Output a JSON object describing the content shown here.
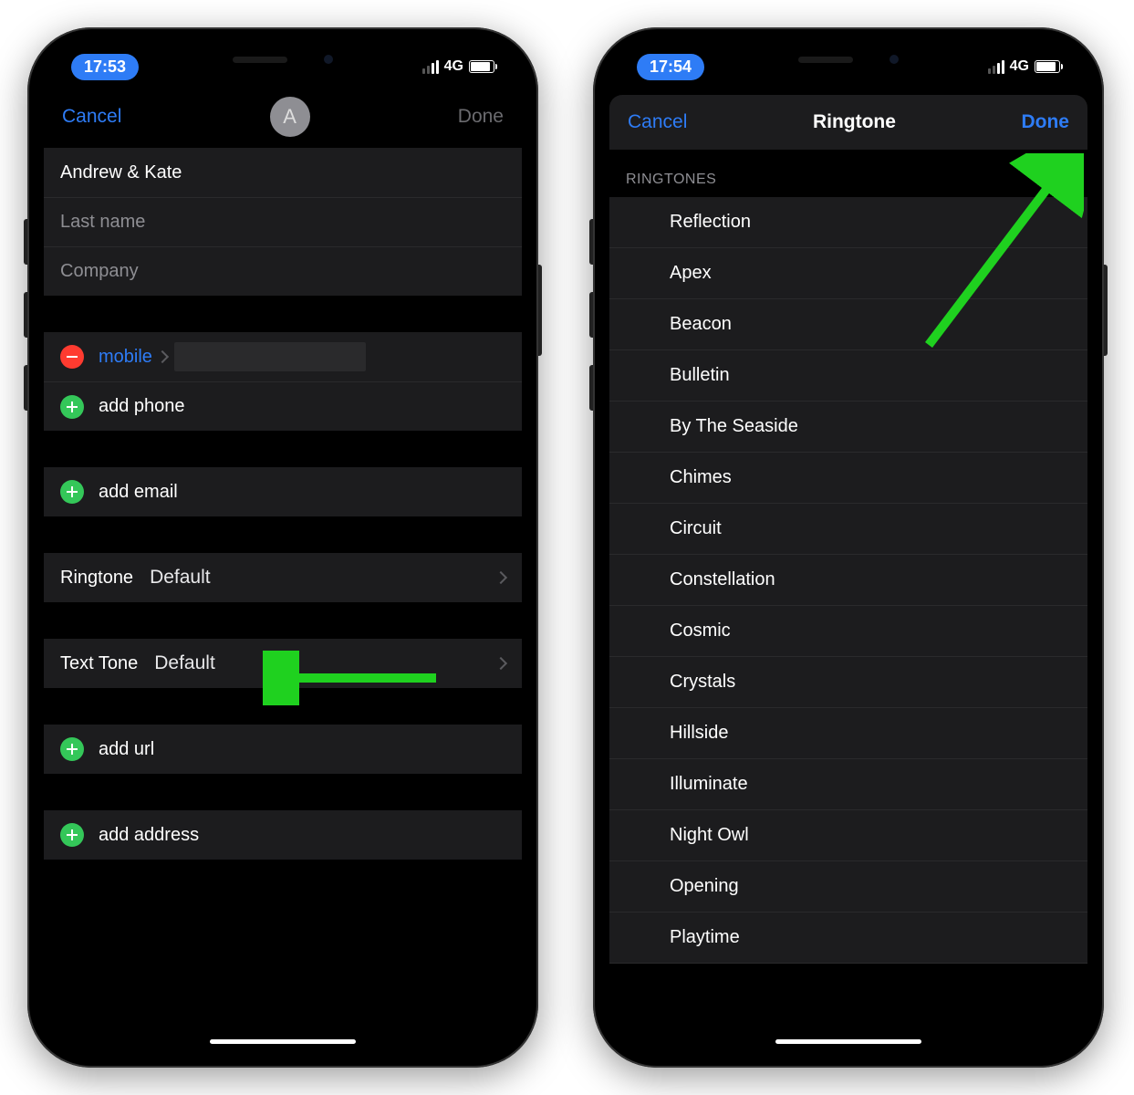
{
  "left": {
    "status": {
      "time": "17:53",
      "network": "4G"
    },
    "nav": {
      "cancel": "Cancel",
      "done": "Done",
      "avatar_initial": "A"
    },
    "name_fields": {
      "first_value": "Andrew & Kate",
      "last_placeholder": "Last name",
      "company_placeholder": "Company"
    },
    "phones": {
      "mobile_label": "mobile",
      "add_phone": "add phone"
    },
    "emails": {
      "add_email": "add email"
    },
    "ringtone": {
      "label": "Ringtone",
      "value": "Default"
    },
    "texttone": {
      "label": "Text Tone",
      "value": "Default"
    },
    "urls": {
      "add_url": "add url"
    },
    "addresses": {
      "add_address": "add address"
    }
  },
  "right": {
    "status": {
      "time": "17:54",
      "network": "4G"
    },
    "nav": {
      "cancel": "Cancel",
      "title": "Ringtone",
      "done": "Done"
    },
    "section_header": "RINGTONES",
    "items": [
      "Reflection",
      "Apex",
      "Beacon",
      "Bulletin",
      "By The Seaside",
      "Chimes",
      "Circuit",
      "Constellation",
      "Cosmic",
      "Crystals",
      "Hillside",
      "Illuminate",
      "Night Owl",
      "Opening",
      "Playtime"
    ]
  }
}
